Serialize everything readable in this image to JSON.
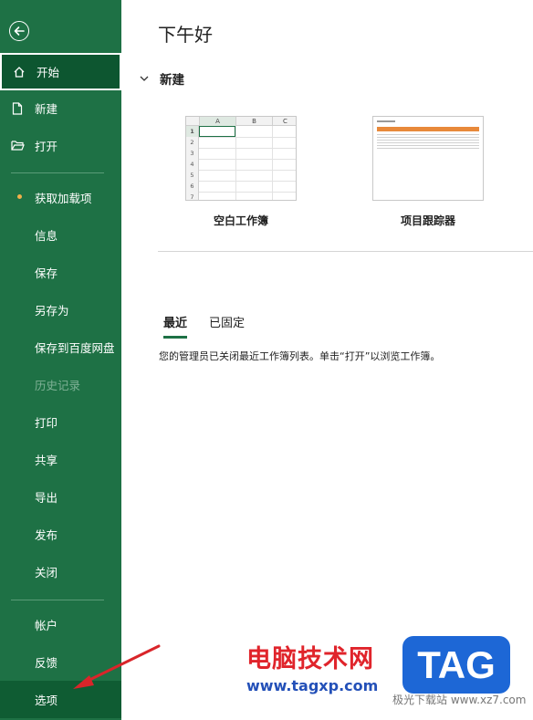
{
  "sidebar": {
    "items": [
      {
        "label": "开始"
      },
      {
        "label": "新建"
      },
      {
        "label": "打开"
      },
      {
        "label": "获取加载项"
      },
      {
        "label": "信息"
      },
      {
        "label": "保存"
      },
      {
        "label": "另存为"
      },
      {
        "label": "保存到百度网盘"
      },
      {
        "label": "历史记录"
      },
      {
        "label": "打印"
      },
      {
        "label": "共享"
      },
      {
        "label": "导出"
      },
      {
        "label": "发布"
      },
      {
        "label": "关闭"
      },
      {
        "label": "帐户"
      },
      {
        "label": "反馈"
      },
      {
        "label": "选项"
      }
    ]
  },
  "main": {
    "greeting": "下午好",
    "new_section": "新建",
    "templates": [
      {
        "label": "空白工作簿"
      },
      {
        "label": "项目跟踪器"
      }
    ],
    "blank_grid": {
      "columns": [
        "A",
        "B",
        "C"
      ],
      "rows": [
        "1",
        "2",
        "3",
        "4",
        "5",
        "6",
        "7"
      ]
    },
    "tabs": [
      {
        "label": "最近"
      },
      {
        "label": "已固定"
      }
    ],
    "message": "您的管理员已关闭最近工作簿列表。单击“打开”以浏览工作簿。"
  },
  "watermark": {
    "text": "电脑技术网",
    "url": "www.tagxp.com",
    "logo": "TAG",
    "small": "极光下载站 www.xz7.com"
  },
  "colors": {
    "sidebar": "#1e7145",
    "accent": "#1e7145",
    "watermark_red": "#e0242b",
    "watermark_blue": "#2350b8",
    "logo_blue": "#1d67d6"
  }
}
